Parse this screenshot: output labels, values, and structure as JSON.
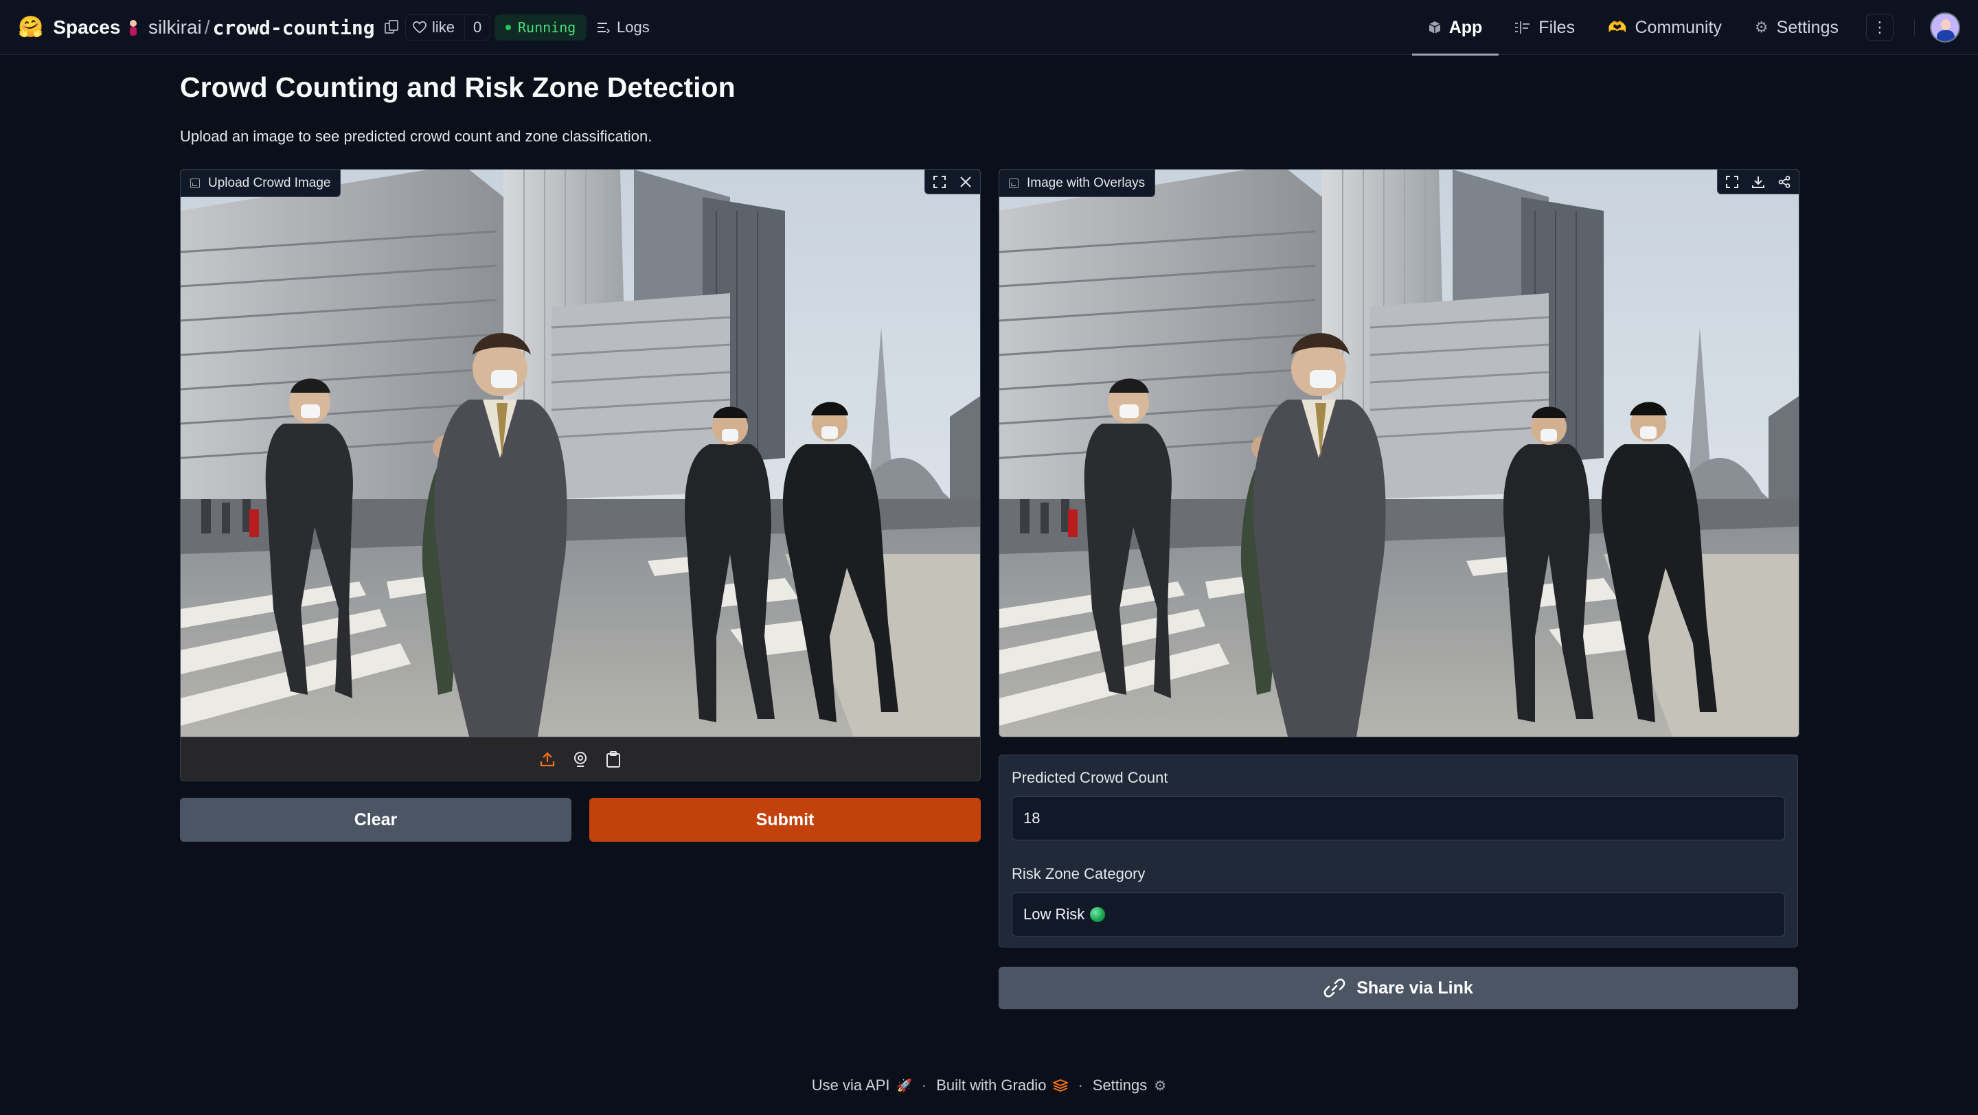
{
  "header": {
    "brand": "Spaces",
    "owner": "silkirai",
    "repo_name": "crowd-counting",
    "like_label": "like",
    "like_count": "0",
    "status": "Running",
    "logs_label": "Logs",
    "tabs": [
      {
        "label": "App",
        "active": true
      },
      {
        "label": "Files",
        "active": false
      },
      {
        "label": "Community",
        "active": false
      },
      {
        "label": "Settings",
        "active": false
      }
    ],
    "status_color": "#4ade80"
  },
  "main": {
    "title": "Crowd Counting and Risk Zone Detection",
    "description": "Upload an image to see predicted crowd count and zone classification.",
    "input_panel": {
      "label": "Upload Crowd Image",
      "source_icons": [
        "upload-icon",
        "webcam-icon",
        "clipboard-icon"
      ]
    },
    "output_panel": {
      "label": "Image with Overlays"
    },
    "buttons": {
      "clear": "Clear",
      "submit": "Submit",
      "share": "Share via Link"
    },
    "outputs": {
      "count_label": "Predicted Crowd Count",
      "count_value": "18",
      "risk_label": "Risk Zone Category",
      "risk_value": "Low Risk"
    },
    "accent_color": "#c2410c"
  },
  "footer": {
    "api": "Use via API",
    "built": "Built with Gradio",
    "settings": "Settings"
  }
}
